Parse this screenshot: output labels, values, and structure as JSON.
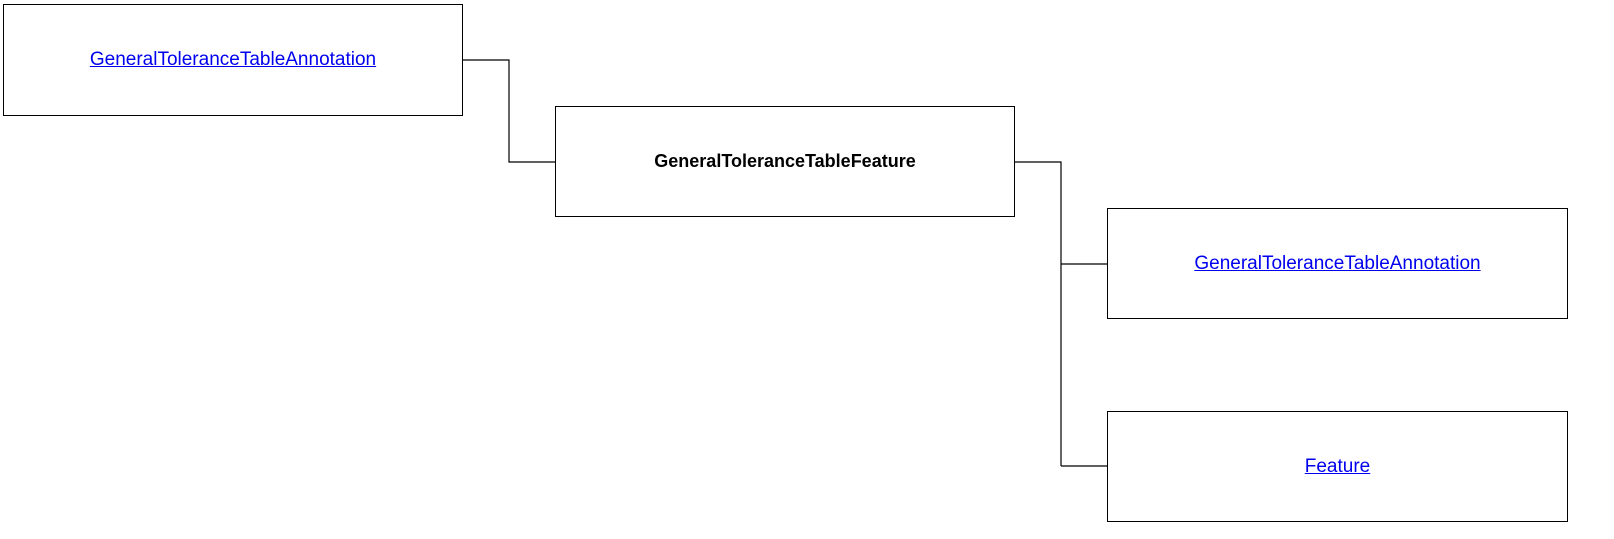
{
  "diagram": {
    "parent_node": {
      "label": "GeneralToleranceTableAnnotation",
      "is_link": true
    },
    "center_node": {
      "label": "GeneralToleranceTableFeature",
      "is_link": false
    },
    "child_nodes": [
      {
        "label": "GeneralToleranceTableAnnotation",
        "is_link": true
      },
      {
        "label": "Feature",
        "is_link": true
      }
    ],
    "colors": {
      "link": "#0000ee",
      "border": "#000000",
      "background": "#ffffff"
    }
  }
}
